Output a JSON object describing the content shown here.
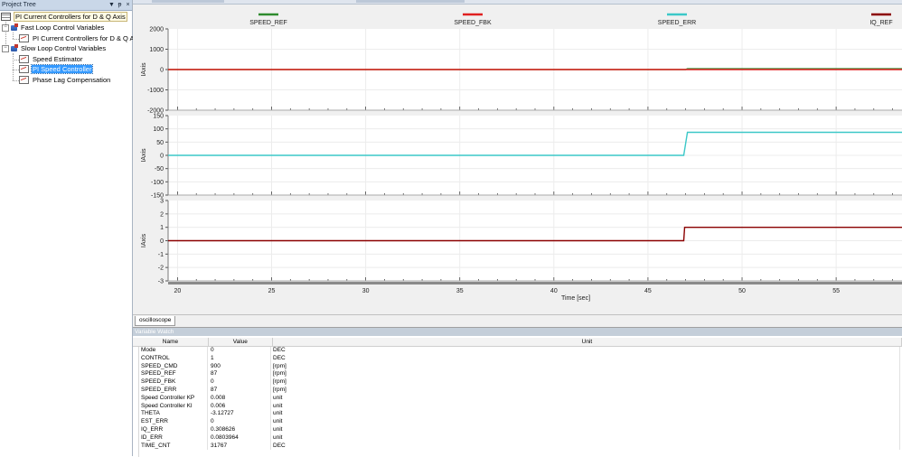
{
  "tree": {
    "panel_title": "Project Tree",
    "root_label": "PI Current Controllers for D & Q Axis",
    "groups": [
      {
        "label": "Fast Loop Control Variables",
        "items": [
          "PI Current Controllers for D & Q Axis"
        ]
      },
      {
        "label": "Slow Loop Control Variables",
        "items": [
          "Speed Estimator",
          "PI Speed Controller",
          "Phase Lag Compensation"
        ]
      }
    ],
    "selected_item": "PI Speed Controller",
    "buttons": {
      "dropdown": "▼",
      "pin": "ᵽ",
      "close": "×"
    }
  },
  "scope": {
    "tab_label": "oscilloscope",
    "legend": [
      {
        "name": "SPEED_REF",
        "color": "#2e8b2e"
      },
      {
        "name": "SPEED_FBK",
        "color": "#e02020"
      },
      {
        "name": "SPEED_ERR",
        "color": "#3cc8c8"
      },
      {
        "name": "IQ_REF",
        "color": "#8b0000"
      }
    ],
    "xlabel": "Time [sec]",
    "x_ticks": [
      "20",
      "25",
      "30",
      "35",
      "40",
      "45",
      "50",
      "55"
    ]
  },
  "chart_data": [
    {
      "type": "line",
      "ylabel": "IAxis",
      "ylim": [
        -2000,
        2000
      ],
      "y_ticks": [
        "2000",
        "1000",
        "0",
        "-1000",
        "-2000"
      ],
      "xlim": [
        19.5,
        58.5
      ],
      "series": [
        {
          "name": "SPEED_REF",
          "color": "#2e8b2e",
          "points": [
            [
              19.5,
              0
            ],
            [
              47.0,
              0
            ],
            [
              47.1,
              40
            ],
            [
              58.5,
              40
            ]
          ]
        },
        {
          "name": "SPEED_FBK",
          "color": "#e02020",
          "points": [
            [
              19.5,
              0
            ],
            [
              58.5,
              0
            ]
          ]
        }
      ]
    },
    {
      "type": "line",
      "ylabel": "IAxis",
      "ylim": [
        -150,
        150
      ],
      "y_ticks": [
        "150",
        "100",
        "50",
        "0",
        "-50",
        "-100",
        "-150"
      ],
      "xlim": [
        19.5,
        58.5
      ],
      "series": [
        {
          "name": "SPEED_ERR",
          "color": "#3cc8c8",
          "points": [
            [
              19.5,
              0
            ],
            [
              46.9,
              0
            ],
            [
              47.1,
              87
            ],
            [
              58.5,
              87
            ]
          ]
        }
      ]
    },
    {
      "type": "line",
      "ylabel": "IAxis",
      "ylim": [
        -3,
        3
      ],
      "y_ticks": [
        "3",
        "2",
        "1",
        "0",
        "-1",
        "-2",
        "-3"
      ],
      "xlim": [
        19.5,
        58.5
      ],
      "series": [
        {
          "name": "IQ_REF",
          "color": "#8b0000",
          "points": [
            [
              19.5,
              0
            ],
            [
              46.9,
              0
            ],
            [
              46.95,
              1
            ],
            [
              58.5,
              1
            ]
          ]
        }
      ]
    }
  ],
  "watch": {
    "title": "Variable Watch",
    "headers": {
      "name": "Name",
      "value": "Value",
      "unit": "Unit"
    },
    "rows": [
      {
        "name": "Mode",
        "value": "0",
        "unit": "DEC"
      },
      {
        "name": "CONTROL",
        "value": "1",
        "unit": "DEC"
      },
      {
        "name": "SPEED_CMD",
        "value": "900",
        "unit": "[rpm]"
      },
      {
        "name": "SPEED_REF",
        "value": "87",
        "unit": "[rpm]"
      },
      {
        "name": "SPEED_FBK",
        "value": "0",
        "unit": "[rpm]"
      },
      {
        "name": "SPEED_ERR",
        "value": "87",
        "unit": "[rpm]"
      },
      {
        "name": "Speed Controller KP",
        "value": "0.008",
        "unit": "unit"
      },
      {
        "name": "Speed Controller KI",
        "value": "0.006",
        "unit": "unit"
      },
      {
        "name": "THETA",
        "value": "-3.12727",
        "unit": "unit"
      },
      {
        "name": "EST_ERR",
        "value": "0",
        "unit": "unit"
      },
      {
        "name": "IQ_ERR",
        "value": "0.308626",
        "unit": "unit"
      },
      {
        "name": "ID_ERR",
        "value": "0.0803964",
        "unit": "unit"
      },
      {
        "name": "TIME_CNT",
        "value": "31767",
        "unit": "DEC"
      }
    ]
  }
}
